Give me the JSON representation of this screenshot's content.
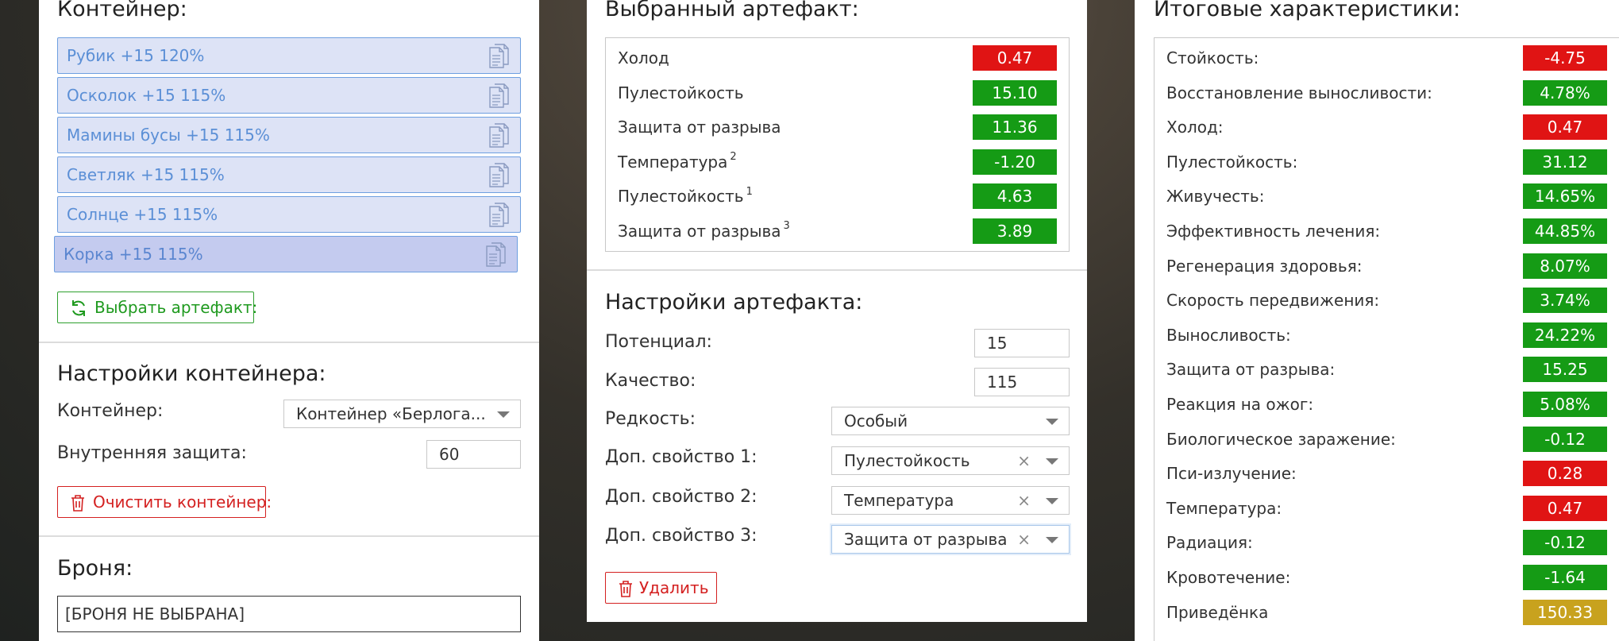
{
  "container_panel": {
    "heading": "Контейнер:",
    "items": [
      {
        "label": "Рубик +15 120%"
      },
      {
        "label": "Осколок +15 115%"
      },
      {
        "label": "Мамины бусы +15 115%"
      },
      {
        "label": "Светляк +15 115%"
      },
      {
        "label": "Солнце +15 115%"
      },
      {
        "label": "Корка +15 115%"
      }
    ],
    "select_artifact_button": "Выбрать артефакт:",
    "settings_heading": "Настройки контейнера:",
    "container_label": "Контейнер:",
    "container_value": "Контейнер «Берлога...",
    "inner_protection_label": "Внутренняя защита:",
    "inner_protection_value": "60",
    "clear_button": "Очистить контейнер:",
    "armor_heading": "Броня:",
    "armor_value": "[БРОНЯ НЕ ВЫБРАНА]"
  },
  "artifact_panel": {
    "heading": "Выбранный артефакт:",
    "stats": [
      {
        "label": "Холод",
        "sup": "",
        "value": "0.47",
        "status": "red"
      },
      {
        "label": "Пулестойкость",
        "sup": "",
        "value": "15.10",
        "status": "green"
      },
      {
        "label": "Защита от разрыва",
        "sup": "",
        "value": "11.36",
        "status": "green"
      },
      {
        "label": "Температура",
        "sup": "2",
        "value": "-1.20",
        "status": "green"
      },
      {
        "label": "Пулестойкость",
        "sup": "1",
        "value": "4.63",
        "status": "green"
      },
      {
        "label": "Защита от разрыва",
        "sup": "3",
        "value": "3.89",
        "status": "green"
      }
    ],
    "settings_heading": "Настройки артефакта:",
    "potential_label": "Потенциал:",
    "potential_value": "15",
    "quality_label": "Качество:",
    "quality_value": "115",
    "rarity_label": "Редкость:",
    "rarity_value": "Особый",
    "extra1_label": "Доп. свойство 1:",
    "extra1_value": "Пулестойкость",
    "extra2_label": "Доп. свойство 2:",
    "extra2_value": "Температура",
    "extra3_label": "Доп. свойство 3:",
    "extra3_value": "Защита от разрыва",
    "clear_symbol": "×",
    "delete_button": "Удалить"
  },
  "totals_panel": {
    "heading": "Итоговые характеристики:",
    "stats": [
      {
        "label": "Стойкость:",
        "value": "-4.75",
        "status": "red"
      },
      {
        "label": "Восстановление выносливости:",
        "value": "4.78%",
        "status": "green"
      },
      {
        "label": "Холод:",
        "value": "0.47",
        "status": "red"
      },
      {
        "label": "Пулестойкость:",
        "value": "31.12",
        "status": "green"
      },
      {
        "label": "Живучесть:",
        "value": "14.65%",
        "status": "green"
      },
      {
        "label": "Эффективность лечения:",
        "value": "44.85%",
        "status": "green"
      },
      {
        "label": "Регенерация здоровья:",
        "value": "8.07%",
        "status": "green"
      },
      {
        "label": "Скорость передвижения:",
        "value": "3.74%",
        "status": "green"
      },
      {
        "label": "Выносливость:",
        "value": "24.22%",
        "status": "green"
      },
      {
        "label": "Защита от разрыва:",
        "value": "15.25",
        "status": "green"
      },
      {
        "label": "Реакция на ожог:",
        "value": "5.08%",
        "status": "green"
      },
      {
        "label": "Биологическое заражение:",
        "value": "-0.12",
        "status": "green"
      },
      {
        "label": "Пси-излучение:",
        "value": "0.28",
        "status": "red"
      },
      {
        "label": "Температура:",
        "value": "0.47",
        "status": "red"
      },
      {
        "label": "Радиация:",
        "value": "-0.12",
        "status": "green"
      },
      {
        "label": "Кровотечение:",
        "value": "-1.64",
        "status": "green"
      },
      {
        "label": "Приведёнка",
        "value": "150.33",
        "status": "gold"
      }
    ]
  },
  "colors": {
    "red": "#e01414",
    "green": "#159b15",
    "gold": "#c8a21e"
  },
  "icons": {
    "item_icon": "document-copy-icon",
    "refresh": "refresh-icon",
    "trash": "trash-icon",
    "dropdown": "chevron-down-icon"
  }
}
